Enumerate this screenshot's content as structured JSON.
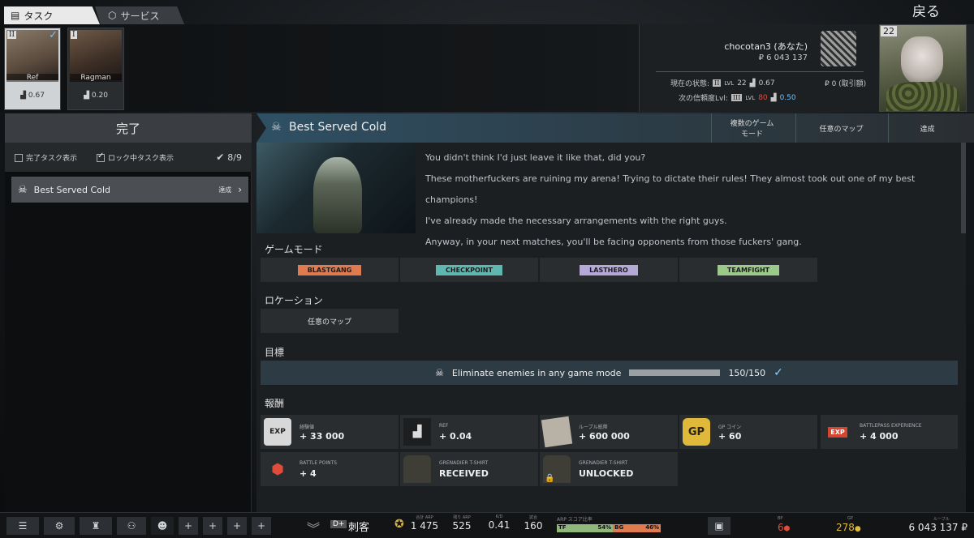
{
  "tabs": {
    "tasks": "タスク",
    "services": "サービス"
  },
  "back_label": "戻る",
  "traders": [
    {
      "rank": "II",
      "name": "Ref",
      "rep": "0.67",
      "selected": true
    },
    {
      "rank": "I",
      "name": "Ragman",
      "rep": "0.20",
      "selected": false
    }
  ],
  "player": {
    "name": "chocotan3 (あなた)",
    "money": "₽ 6 043 137",
    "current_label": "現在の状態:",
    "current_rank": "II",
    "current_lvl_prefix": "LVL",
    "current_lvl": "22",
    "current_rep": "0.67",
    "trade_money": "₽ 0 (取引額)",
    "next_label": "次の信頼度Lvl:",
    "next_rank": "III",
    "next_lvl_prefix": "LVL",
    "next_lvl": "80",
    "next_rep": "0.50",
    "level": "22"
  },
  "left": {
    "header": "完了",
    "filter_completed": "完了タスク表示",
    "filter_locked": "ロック中タスク表示",
    "count": "8/9",
    "task_name": "Best Served Cold",
    "task_status": "達成"
  },
  "task": {
    "title": "Best Served Cold",
    "col_modes": "複数のゲーム\nモード",
    "col_map": "任意のマップ",
    "col_status": "達成",
    "story": [
      "You didn't think I'd just leave it like that, did you?",
      "These motherfuckers are ruining my arena! Trying to dictate their rules! They almost took out one of my best champions!",
      "I've already made the necessary arrangements with the right guys.",
      "Anyway, in your next matches, you'll be facing opponents from those fuckers' gang."
    ],
    "modes_label": "ゲームモード",
    "modes": [
      {
        "name": "BLASTGANG",
        "color": "#e07a4f"
      },
      {
        "name": "CHECKPOINT",
        "color": "#5fb8b0"
      },
      {
        "name": "LASTHERO",
        "color": "#b6a9d8"
      },
      {
        "name": "TEAMFIGHT",
        "color": "#9cc98a"
      }
    ],
    "location_label": "ロケーション",
    "location": "任意のマップ",
    "objective_label": "目標",
    "objective": "Eliminate enemies in any game mode",
    "objective_progress": "150/150",
    "objective_fraction": 1.0,
    "rewards_label": "報酬",
    "rewards": [
      {
        "icon": "EXP",
        "name": "経験値",
        "value": "+ 33 000"
      },
      {
        "icon": "rep",
        "name": "REF",
        "value": "+ 0.04"
      },
      {
        "icon": "money",
        "name": "ルーブル紙幣",
        "value": "+ 600 000"
      },
      {
        "icon": "GP",
        "name": "GP コイン",
        "value": "+ 60"
      },
      {
        "icon": "EXP",
        "name": "BATTLEPASS EXPERIENCE",
        "value": "+ 4 000"
      },
      {
        "icon": "bp",
        "name": "BATTLE POINTS",
        "value": "+ 4"
      },
      {
        "icon": "shirt",
        "name": "GRENADIER T-SHIRT",
        "value": "RECEIVED"
      },
      {
        "icon": "shirt",
        "name": "GRENADIER T-SHIRT",
        "value": "UNLOCKED"
      }
    ]
  },
  "bottom": {
    "rank_badge": "D+",
    "rank_name": "刺客",
    "total_arp_label": "合計 ARP",
    "total_arp": "1 475",
    "remaining_arp_label": "残り ARP",
    "remaining_arp": "525",
    "kd_label": "K/D",
    "kd": "0.41",
    "matches_label": "試合",
    "matches": "160",
    "score_ratio_label": "ARP スコア比率",
    "tf_label": "TF",
    "tf_pct": "54%",
    "bg_label": "BG",
    "bg_pct": "46%",
    "tf_fraction": 0.54,
    "bp_label": "BP",
    "bp": "6",
    "gp_label": "GP",
    "gp": "278",
    "roubles_label": "ルーブル",
    "roubles": "6 043 137 ₽"
  },
  "colors": {
    "accent": "#66c4ff",
    "check": "#8fd0ff"
  }
}
